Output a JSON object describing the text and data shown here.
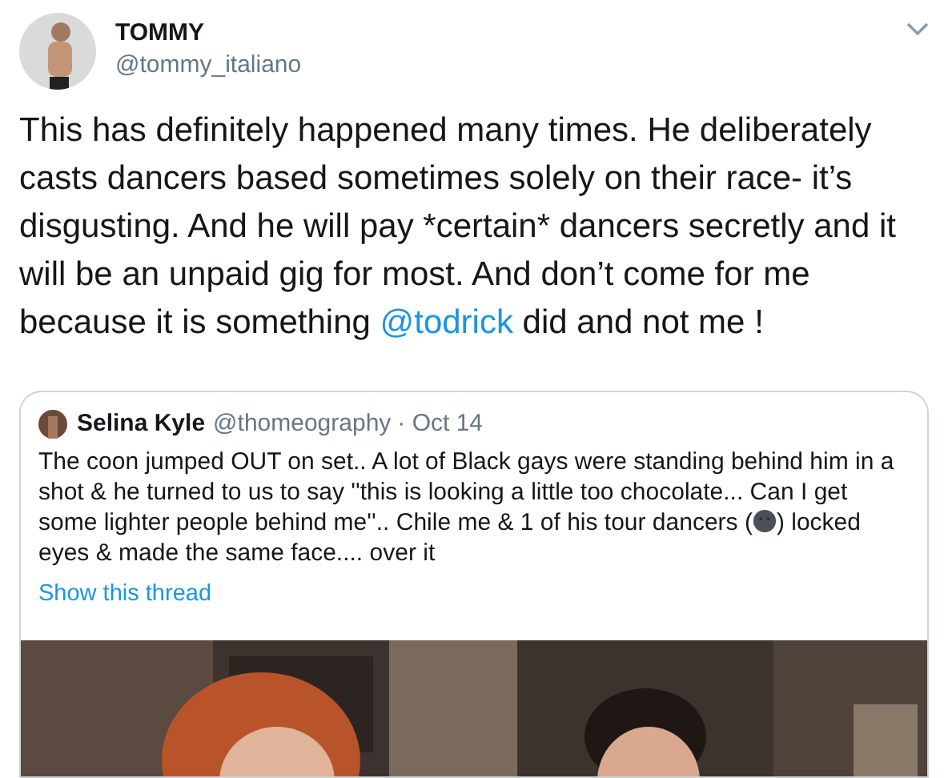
{
  "tweet": {
    "display_name": "TOMMY",
    "handle": "@tommy_italiano",
    "text_parts": [
      {
        "kind": "text",
        "text": "This has definitely happened many times. He deliberately casts dancers based sometimes solely on their race- it’s disgusting. And he will pay *certain* dancers secretly and it will be an unpaid gig for most. And don’t come for me because it is something "
      },
      {
        "kind": "mention",
        "text": "@todrick"
      },
      {
        "kind": "text",
        "text": " did and not me !"
      }
    ]
  },
  "quoted_tweet": {
    "display_name": "Selina Kyle",
    "handle": "@thomeography",
    "date": "· Oct 14",
    "text_parts": [
      {
        "kind": "text",
        "text": "The coon jumped OUT on set.. A lot of  Black gays were standing behind him in a shot & he turned to us to say ''this is looking a little too chocolate... Can I get some lighter people behind me''.. Chile me & 1 of his tour dancers ("
      },
      {
        "kind": "emoji"
      },
      {
        "kind": "text",
        "text": ") locked eyes & made the same face.... over it"
      }
    ],
    "thread_link": "Show this thread"
  }
}
